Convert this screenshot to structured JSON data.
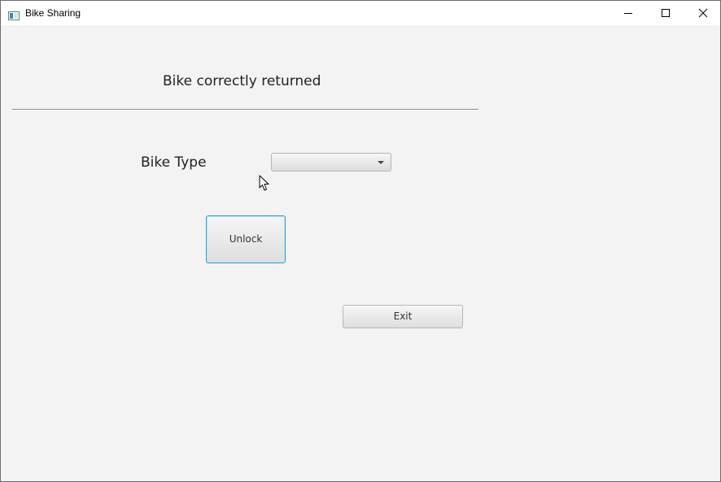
{
  "window": {
    "title": "Bike Sharing",
    "app_icon": "window-icon",
    "controls": {
      "minimize_icon": "minimize-icon",
      "maximize_icon": "maximize-icon",
      "close_icon": "close-icon"
    }
  },
  "main": {
    "status_text": "Bike correctly returned",
    "bike_type_label": "Bike Type",
    "bike_type_select": {
      "value": "",
      "arrow_icon": "chevron-down-icon"
    },
    "unlock_label": "Unlock",
    "exit_label": "Exit"
  },
  "colors": {
    "background": "#f3f3f3",
    "focus_border": "#2a9fd6",
    "titlebar": "#ffffff"
  },
  "cursor_icon": "mouse-pointer-icon"
}
